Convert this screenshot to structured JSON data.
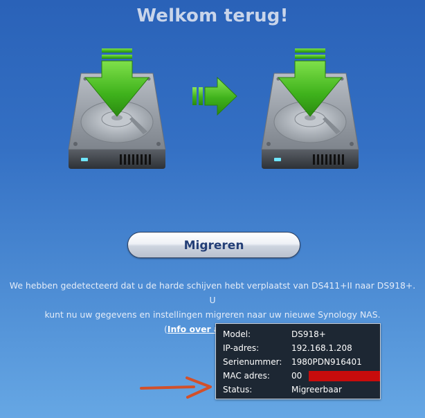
{
  "header": {
    "title": "Welkom terug!"
  },
  "icons": {
    "source_drive": "hard-drive-download-icon",
    "target_drive": "hard-drive-download-icon",
    "transfer_arrow": "arrow-right-icon",
    "pointer_arrow": "red-arrow-icon"
  },
  "actions": {
    "migrate_label": "Migreren"
  },
  "message": {
    "line1": "We hebben gedetecteerd dat u de harde schijven hebt verplaatst van DS411+II naar DS918+. U",
    "line2": "kunt nu uw gegevens en instellingen migreren naar uw nieuwe Synology NAS.",
    "paren_open": "(",
    "info_link": "Info over apparaat",
    "paren_close": ")"
  },
  "device_info": {
    "model_label": "Model:",
    "model_value": "DS918+",
    "ip_label": "IP-adres:",
    "ip_value": "192.168.1.208",
    "serial_label": "Serienummer:",
    "serial_value": "1980PDN916401",
    "mac_label": "MAC adres:",
    "mac_value_visible": "00",
    "status_label": "Status:",
    "status_value": "Migreerbaar"
  },
  "colors": {
    "background_top": "#2a62b8",
    "background_bottom": "#66a7e4",
    "title": "#c9d5ea",
    "button_text": "#243f77",
    "arrow_green": "#3fb21c",
    "redaction": "#c80c0c",
    "pointer_arrow": "#d2502a",
    "info_box_bg": "#1d2733"
  }
}
